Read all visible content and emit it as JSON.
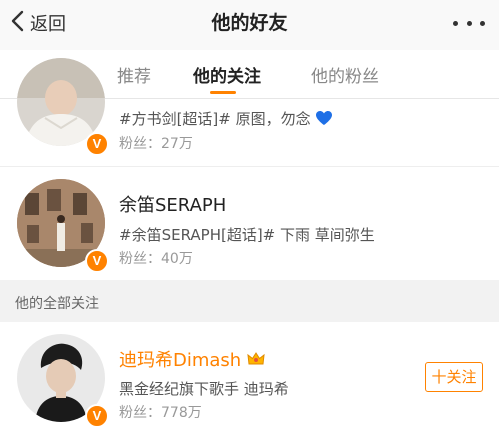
{
  "navbar": {
    "back_label": "返回",
    "title": "他的好友"
  },
  "tabs": [
    {
      "label": "推荐",
      "active": false
    },
    {
      "label": "他的关注",
      "active": true
    },
    {
      "label": "他的粉丝",
      "active": false
    }
  ],
  "friends": [
    {
      "desc": "#方书剑[超话]# 原图，勿念",
      "fans": "粉丝：27万",
      "verified": true
    },
    {
      "name": "余笛SERAPH",
      "desc": "#余笛SERAPH[超话]# 下雨 草间弥生",
      "fans": "粉丝：40万",
      "verified": true
    }
  ],
  "section": {
    "label": "他的全部关注"
  },
  "all_follows": [
    {
      "name": "迪玛希Dimash",
      "desc": "黑金经纪旗下歌手 迪玛希",
      "fans": "粉丝：778万",
      "verified": true,
      "follow_label": "十关注"
    }
  ],
  "colors": {
    "accent": "#ff8200",
    "heart": "#1e6fe6"
  },
  "badge_letter": "V"
}
